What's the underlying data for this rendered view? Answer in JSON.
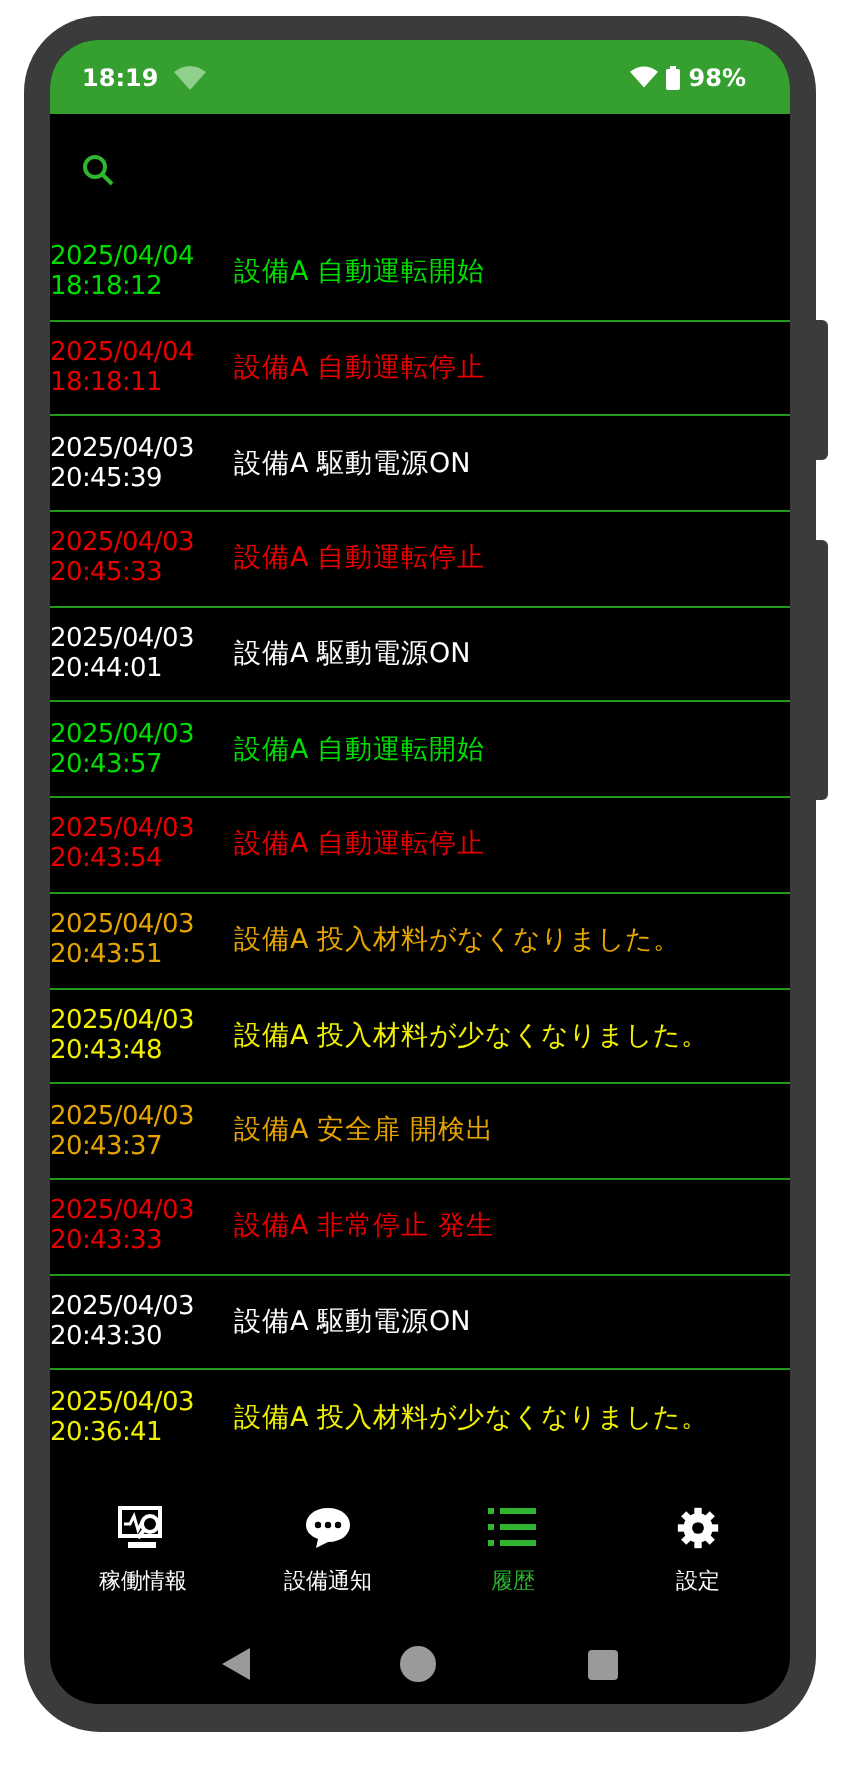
{
  "status_bar": {
    "time": "18:19",
    "battery": "98%"
  },
  "history": [
    {
      "date": "2025/04/04",
      "time": "18:18:12",
      "message": "設備A 自動運転開始",
      "color": "#00dd00"
    },
    {
      "date": "2025/04/04",
      "time": "18:18:11",
      "message": "設備A 自動運転停止",
      "color": "#e80000"
    },
    {
      "date": "2025/04/03",
      "time": "20:45:39",
      "message": "設備A 駆動電源ON",
      "color": "#ffffff"
    },
    {
      "date": "2025/04/03",
      "time": "20:45:33",
      "message": "設備A 自動運転停止",
      "color": "#e80000"
    },
    {
      "date": "2025/04/03",
      "time": "20:44:01",
      "message": "設備A 駆動電源ON",
      "color": "#ffffff"
    },
    {
      "date": "2025/04/03",
      "time": "20:43:57",
      "message": "設備A 自動運転開始",
      "color": "#00dd00"
    },
    {
      "date": "2025/04/03",
      "time": "20:43:54",
      "message": "設備A 自動運転停止",
      "color": "#e80000"
    },
    {
      "date": "2025/04/03",
      "time": "20:43:51",
      "message": "設備A 投入材料がなくなりました。",
      "color": "#e6a400"
    },
    {
      "date": "2025/04/03",
      "time": "20:43:48",
      "message": "設備A 投入材料が少なくなりました。",
      "color": "#f0f000"
    },
    {
      "date": "2025/04/03",
      "time": "20:43:37",
      "message": "設備A 安全扉 開検出",
      "color": "#e6a400"
    },
    {
      "date": "2025/04/03",
      "time": "20:43:33",
      "message": "設備A 非常停止 発生",
      "color": "#e80000"
    },
    {
      "date": "2025/04/03",
      "time": "20:43:30",
      "message": "設備A 駆動電源ON",
      "color": "#ffffff"
    },
    {
      "date": "2025/04/03",
      "time": "20:36:41",
      "message": "設備A 投入材料が少なくなりました。",
      "color": "#f0f000"
    }
  ],
  "bottom_nav": [
    {
      "label": "稼働情報",
      "kind": "monitor",
      "selected": false
    },
    {
      "label": "設備通知",
      "kind": "chat",
      "selected": false
    },
    {
      "label": "履歴",
      "kind": "list",
      "selected": true
    },
    {
      "label": "設定",
      "kind": "gear",
      "selected": false
    }
  ]
}
